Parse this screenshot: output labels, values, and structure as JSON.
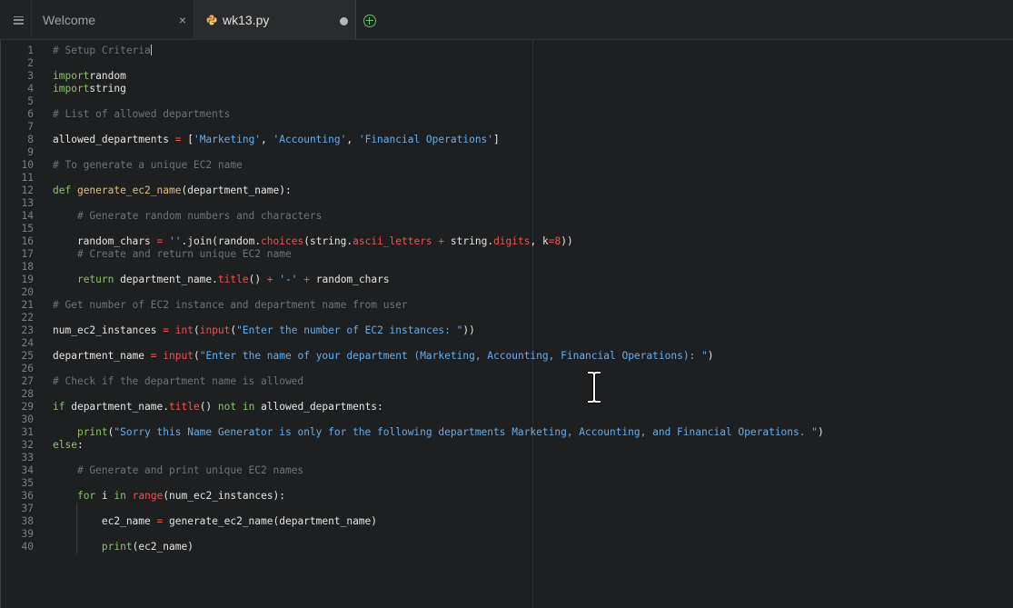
{
  "tabs": {
    "welcome": {
      "label": "Welcome",
      "close": "×"
    },
    "file": {
      "label": "wk13.py"
    }
  },
  "colors": {
    "comment": "#6e7377",
    "keyword": "#8cc265",
    "function": "#e5c07b",
    "string": "#62aeef",
    "builtin": "#f0514e",
    "add_tab": "#5cbf6a"
  },
  "icons": {
    "menu": "hamburger-icon",
    "file": "python-file-icon",
    "add": "plus-circle-icon",
    "dirty": "unsaved-dot-icon",
    "mouse": "text-cursor-icon"
  },
  "editor": {
    "line_numbers": [
      "1",
      "2",
      "3",
      "4",
      "5",
      "6",
      "7",
      "8",
      "9",
      "10",
      "11",
      "12",
      "13",
      "14",
      "15",
      "16",
      "17",
      "18",
      "19",
      "20",
      "21",
      "22",
      "23",
      "24",
      "25",
      "26",
      "27",
      "28",
      "29",
      "30",
      "31",
      "32",
      "33",
      "34",
      "35",
      "36",
      "37",
      "38",
      "39",
      "40"
    ],
    "lines": [
      [
        [
          "cm",
          "# Setup Criteria"
        ]
      ],
      [],
      [
        [
          "kw",
          "import"
        ],
        [
          "",
          "random"
        ]
      ],
      [
        [
          "kw",
          "import"
        ],
        [
          "",
          "string"
        ]
      ],
      [],
      [
        [
          "cm",
          "# List of allowed departments"
        ]
      ],
      [],
      [
        [
          "",
          "allowed_departments "
        ],
        [
          "op",
          "="
        ],
        [
          "",
          " ["
        ],
        [
          "st",
          "'Marketing'"
        ],
        [
          "",
          ", "
        ],
        [
          "st",
          "'Accounting'"
        ],
        [
          "",
          ", "
        ],
        [
          "st",
          "'Financial Operations'"
        ],
        [
          "",
          "]"
        ]
      ],
      [],
      [
        [
          "cm",
          "# To generate a unique EC2 name"
        ]
      ],
      [],
      [
        [
          "kw",
          "def "
        ],
        [
          "fn",
          "generate_ec2_name"
        ],
        [
          "",
          "(department_name):"
        ]
      ],
      [],
      [
        [
          "",
          "    "
        ],
        [
          "cm",
          "# Generate random numbers and characters"
        ]
      ],
      [],
      [
        [
          "",
          "    random_chars "
        ],
        [
          "op",
          "="
        ],
        [
          "",
          " "
        ],
        [
          "st",
          "''"
        ],
        [
          "",
          ".join(random."
        ],
        [
          "bi",
          "choices"
        ],
        [
          "",
          "(string."
        ],
        [
          "bi",
          "ascii_letters"
        ],
        [
          "",
          " "
        ],
        [
          "op",
          "+"
        ],
        [
          "",
          " string."
        ],
        [
          "bi",
          "digits"
        ],
        [
          "",
          ", k"
        ],
        [
          "op",
          "="
        ],
        [
          "nm",
          "8"
        ],
        [
          "",
          "))"
        ]
      ],
      [
        [
          "",
          "    "
        ],
        [
          "cm",
          "# Create and return unique EC2 name"
        ]
      ],
      [],
      [
        [
          "",
          "    "
        ],
        [
          "kw",
          "return"
        ],
        [
          "",
          " department_name."
        ],
        [
          "bi",
          "title"
        ],
        [
          "",
          "() "
        ],
        [
          "op",
          "+"
        ],
        [
          "",
          " "
        ],
        [
          "st",
          "'-'"
        ],
        [
          "",
          " "
        ],
        [
          "op",
          "+"
        ],
        [
          "",
          " random_chars"
        ]
      ],
      [],
      [
        [
          "cm",
          "# Get number of EC2 instance and department name from user"
        ]
      ],
      [],
      [
        [
          "",
          "num_ec2_instances "
        ],
        [
          "op",
          "="
        ],
        [
          "",
          " "
        ],
        [
          "bi",
          "int"
        ],
        [
          "",
          "("
        ],
        [
          "bi",
          "input"
        ],
        [
          "",
          "("
        ],
        [
          "st",
          "\"Enter the number of EC2 instances: \""
        ],
        [
          "",
          "))"
        ]
      ],
      [],
      [
        [
          "",
          "department_name "
        ],
        [
          "op",
          "="
        ],
        [
          "",
          " "
        ],
        [
          "bi",
          "input"
        ],
        [
          "",
          "("
        ],
        [
          "st",
          "\"Enter the name of your department (Marketing, Accounting, Financial Operations): \""
        ],
        [
          "",
          ")"
        ]
      ],
      [],
      [
        [
          "cm",
          "# Check if the department name is allowed"
        ]
      ],
      [],
      [
        [
          "kw",
          "if"
        ],
        [
          "",
          " department_name."
        ],
        [
          "bi",
          "title"
        ],
        [
          "",
          "() "
        ],
        [
          "kw",
          "not in"
        ],
        [
          "",
          " allowed_departments:"
        ]
      ],
      [],
      [
        [
          "",
          "    "
        ],
        [
          "kw",
          "print"
        ],
        [
          "",
          "("
        ],
        [
          "st",
          "\"Sorry this Name Generator is only for the following departments Marketing, Accounting, and Financial Operations. \""
        ],
        [
          "",
          ")"
        ]
      ],
      [
        [
          "kw",
          "else"
        ],
        [
          "",
          ":"
        ]
      ],
      [],
      [
        [
          "",
          "    "
        ],
        [
          "cm",
          "# Generate and print unique EC2 names"
        ]
      ],
      [],
      [
        [
          "",
          "    "
        ],
        [
          "kw",
          "for"
        ],
        [
          "",
          " i "
        ],
        [
          "kw",
          "in"
        ],
        [
          "",
          " "
        ],
        [
          "bi",
          "range"
        ],
        [
          "",
          "(num_ec2_instances):"
        ]
      ],
      [],
      [
        [
          "",
          "        ec2_name "
        ],
        [
          "op",
          "="
        ],
        [
          "",
          " generate_ec2_name(department_name)"
        ]
      ],
      [],
      [
        [
          "",
          "        "
        ],
        [
          "kw",
          "print"
        ],
        [
          "",
          "(ec2_name)"
        ]
      ]
    ]
  }
}
